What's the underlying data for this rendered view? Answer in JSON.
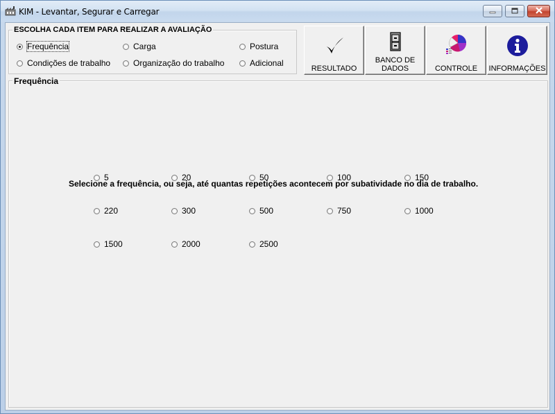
{
  "window": {
    "title": "KIM - Levantar, Segurar e Carregar"
  },
  "evaluation_group": {
    "legend": "ESCOLHA CADA ITEM PARA REALIZAR A AVALIAÇÃO",
    "options": [
      {
        "label": "Frequência",
        "checked": true
      },
      {
        "label": "Carga",
        "checked": false
      },
      {
        "label": "Postura",
        "checked": false
      },
      {
        "label": "Condições de trabalho",
        "checked": false
      },
      {
        "label": "Organização do trabalho",
        "checked": false
      },
      {
        "label": "Adicional",
        "checked": false
      }
    ]
  },
  "toolbar": {
    "resultado": "RESULTADO",
    "banco_line1": "BANCO DE",
    "banco_line2": "DADOS",
    "controle": "CONTROLE",
    "informacoes": "INFORMAÇÕES"
  },
  "frequency_panel": {
    "legend": "Frequência",
    "instruction": "Selecione a frequência, ou seja, até quantas repetições acontecem por subatividade no dia de trabalho.",
    "values": [
      "5",
      "20",
      "50",
      "100",
      "150",
      "220",
      "300",
      "500",
      "750",
      "1000",
      "1500",
      "2000",
      "2500"
    ]
  },
  "colors": {
    "window_bg": "#f0f0f0",
    "info_icon": "#1c1c9c",
    "close_button": "#c2432e"
  }
}
